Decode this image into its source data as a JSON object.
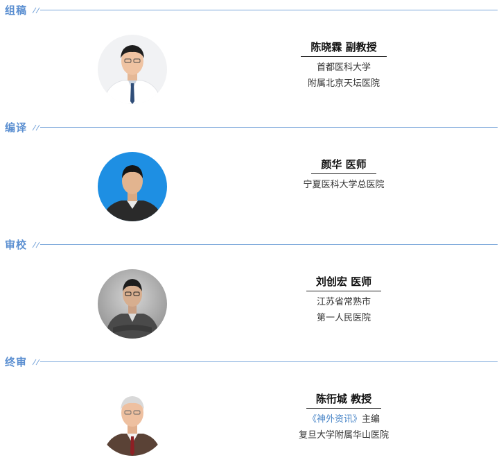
{
  "sections": [
    {
      "title": "组稿",
      "person": {
        "name": "陈晓霖 副教授",
        "affiliation": [
          "首都医科大学",
          "附属北京天坛医院"
        ]
      }
    },
    {
      "title": "编译",
      "person": {
        "name": "颜华 医师",
        "affiliation": [
          "宁夏医科大学总医院"
        ]
      }
    },
    {
      "title": "审校",
      "person": {
        "name": "刘创宏 医师",
        "affiliation": [
          "江苏省常熟市",
          "第一人民医院"
        ]
      }
    },
    {
      "title": "终审",
      "person": {
        "name": "陈衎城 教授",
        "journal": "《神外资讯》",
        "journal_role": "主编",
        "affiliation": [
          "复旦大学附属华山医院"
        ]
      }
    }
  ],
  "colors": {
    "accent": "#5b8fd1",
    "journal": "#4a86c8",
    "avatar_blue_bg": "#1e8fe3"
  }
}
